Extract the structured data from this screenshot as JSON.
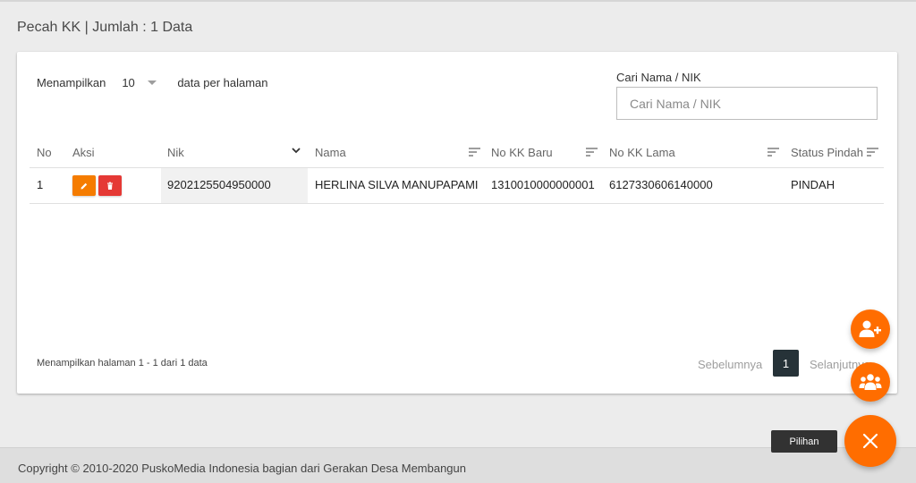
{
  "page": {
    "title": "Pecah KK | Jumlah : 1 Data"
  },
  "table_controls": {
    "show_label": "Menampilkan",
    "per_page_value": "10",
    "per_page_suffix": "data per halaman",
    "search_label": "Cari Nama / NIK",
    "search_placeholder": "Cari Nama / NIK",
    "search_value": ""
  },
  "table": {
    "columns": [
      "No",
      "Aksi",
      "Nik",
      "Nama",
      "No KK Baru",
      "No KK Lama",
      "Status Pindah"
    ],
    "rows": [
      {
        "no": "1",
        "nik": "9202125504950000",
        "nama": "HERLINA SILVA MANUPAPAMI",
        "no_kk_baru": "1310010000000001",
        "no_kk_lama": "6127330606140000",
        "status_pindah": "PINDAH"
      }
    ]
  },
  "pagination": {
    "info": "Menampilkan halaman 1 - 1 dari 1 data",
    "prev_label": "Sebelumnya",
    "current_page": "1",
    "next_label": "Selanjutnya"
  },
  "fab": {
    "tooltip": "Pilihan"
  },
  "footer": {
    "text": "Copyright © 2010-2020 PuskoMedia Indonesia bagian dari Gerakan Desa Membangun"
  },
  "colors": {
    "accent": "#ff6d00",
    "edit": "#f57c00",
    "delete": "#e53935",
    "page_active": "#263238"
  },
  "icons": [
    "pencil-icon",
    "trash-icon",
    "sort-icon",
    "chevron-down-icon",
    "user-plus-icon",
    "users-group-icon",
    "close-icon"
  ]
}
